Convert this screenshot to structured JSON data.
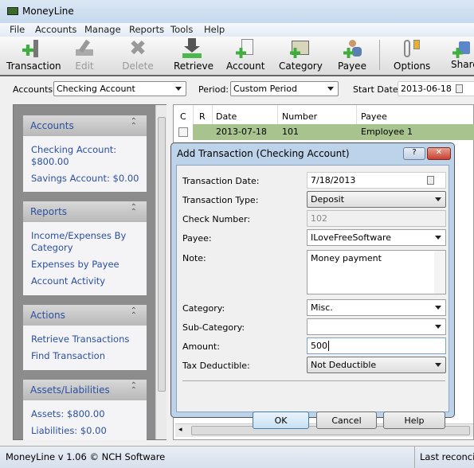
{
  "window": {
    "title": "MoneyLine"
  },
  "menu": [
    "File",
    "Accounts",
    "Manage",
    "Reports",
    "Tools",
    "Help"
  ],
  "toolbar": [
    {
      "label": "Transaction",
      "icon": "add-transaction-icon",
      "enabled": true
    },
    {
      "label": "Edit",
      "icon": "edit-icon",
      "enabled": false
    },
    {
      "label": "Delete",
      "icon": "delete-icon",
      "enabled": false
    },
    {
      "label": "Retrieve",
      "icon": "retrieve-icon",
      "enabled": true
    },
    {
      "label": "Account",
      "icon": "add-account-icon",
      "enabled": true
    },
    {
      "label": "Category",
      "icon": "add-category-icon",
      "enabled": true
    },
    {
      "label": "Payee",
      "icon": "add-payee-icon",
      "enabled": true
    },
    {
      "label": "Options",
      "icon": "options-icon",
      "enabled": true
    },
    {
      "label": "Share",
      "icon": "share-icon",
      "enabled": true
    }
  ],
  "filter": {
    "accounts_label": "Accounts:",
    "accounts_value": "Checking Account",
    "period_label": "Period:",
    "period_value": "Custom Period",
    "start_label": "Start Date:",
    "start_value": "2013-06-18"
  },
  "sidebar": {
    "accounts": {
      "title": "Accounts",
      "items": [
        "Checking Account: $800.00",
        "Savings Account: $0.00"
      ]
    },
    "reports": {
      "title": "Reports",
      "items": [
        "Income/Expenses By Category",
        "Expenses by Payee",
        "Account Activity"
      ]
    },
    "actions": {
      "title": "Actions",
      "items": [
        "Retrieve Transactions",
        "Find Transaction"
      ]
    },
    "assets": {
      "title": "Assets/Liabilities",
      "items": [
        "Assets: $800.00",
        "Liabilities: $0.00"
      ]
    }
  },
  "grid": {
    "columns": [
      "C",
      "R",
      "Date",
      "Number",
      "Payee"
    ],
    "rows": [
      {
        "checked": false,
        "date": "2013-07-18",
        "number": "101",
        "payee": "Employee 1"
      }
    ]
  },
  "dialog": {
    "title": "Add Transaction (Checking Account)",
    "fields": {
      "date": {
        "label": "Transaction Date:",
        "value": "7/18/2013"
      },
      "type": {
        "label": "Transaction Type:",
        "value": "Deposit"
      },
      "check": {
        "label": "Check Number:",
        "value": "102"
      },
      "payee": {
        "label": "Payee:",
        "value": "ILoveFreeSoftware"
      },
      "note": {
        "label": "Note:",
        "value": "Money payment"
      },
      "category": {
        "label": "Category:",
        "value": "Misc."
      },
      "subcategory": {
        "label": "Sub-Category:",
        "value": ""
      },
      "amount": {
        "label": "Amount:",
        "value": "500"
      },
      "tax": {
        "label": "Tax Deductible:",
        "value": "Not Deductible"
      }
    },
    "ok": "OK",
    "cancel": "Cancel",
    "help": "Help"
  },
  "status": {
    "left": "MoneyLine v 1.06 © NCH Software",
    "right": "Last reconcile"
  }
}
